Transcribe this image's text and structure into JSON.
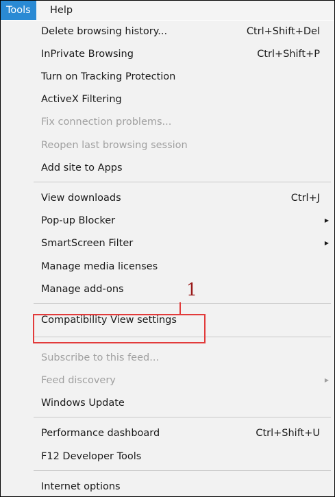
{
  "menubar": {
    "items": [
      {
        "label": "Tools",
        "active": true
      },
      {
        "label": "Help",
        "active": false
      }
    ]
  },
  "menu": {
    "items": [
      {
        "label": "Delete browsing history...",
        "shortcut": "Ctrl+Shift+Del",
        "disabled": false
      },
      {
        "label": "InPrivate Browsing",
        "shortcut": "Ctrl+Shift+P",
        "disabled": false
      },
      {
        "label": "Turn on Tracking Protection",
        "shortcut": "",
        "disabled": false
      },
      {
        "label": "ActiveX Filtering",
        "shortcut": "",
        "disabled": false
      },
      {
        "label": "Fix connection problems...",
        "shortcut": "",
        "disabled": true
      },
      {
        "label": "Reopen last browsing session",
        "shortcut": "",
        "disabled": true
      },
      {
        "label": "Add site to Apps",
        "shortcut": "",
        "disabled": false
      },
      {
        "label": "View downloads",
        "shortcut": "Ctrl+J",
        "disabled": false
      },
      {
        "label": "Pop-up Blocker",
        "shortcut": "",
        "disabled": false,
        "submenu": true
      },
      {
        "label": "SmartScreen Filter",
        "shortcut": "",
        "disabled": false,
        "submenu": true
      },
      {
        "label": "Manage media licenses",
        "shortcut": "",
        "disabled": false
      },
      {
        "label": "Manage add-ons",
        "shortcut": "",
        "disabled": false
      },
      {
        "label": "Compatibility View settings",
        "shortcut": "",
        "disabled": false
      },
      {
        "label": "Subscribe to this feed...",
        "shortcut": "",
        "disabled": true
      },
      {
        "label": "Feed discovery",
        "shortcut": "",
        "disabled": true,
        "submenu": true
      },
      {
        "label": "Windows Update",
        "shortcut": "",
        "disabled": false
      },
      {
        "label": "Performance dashboard",
        "shortcut": "Ctrl+Shift+U",
        "disabled": false
      },
      {
        "label": "F12 Developer Tools",
        "shortcut": "",
        "disabled": false
      },
      {
        "label": "Internet options",
        "shortcut": "",
        "disabled": false
      }
    ],
    "submenu_arrow": "▶"
  },
  "annotation": {
    "number": "1",
    "color": "#e23b3b",
    "target": "Compatibility View settings"
  },
  "colors": {
    "menubar_active": "#2a8ad4",
    "menu_background": "#f2f2f2",
    "disabled_text": "#a0a0a0"
  }
}
